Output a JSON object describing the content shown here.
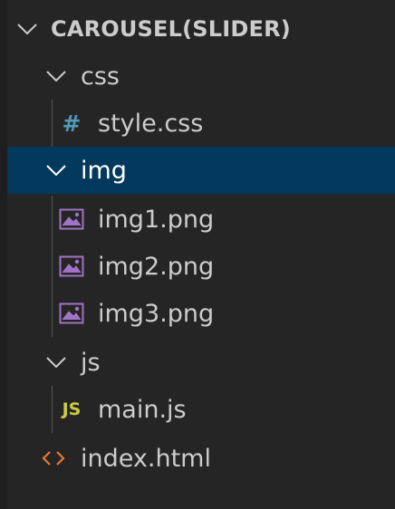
{
  "explorer": {
    "root": {
      "label": "CAROUSEL(SLIDER)",
      "expanded": true
    },
    "css_folder": {
      "label": "css",
      "expanded": true
    },
    "css_files": [
      {
        "label": "style.css",
        "icon": "css-hash-icon"
      }
    ],
    "img_folder": {
      "label": "img",
      "expanded": true,
      "selected": true
    },
    "img_files": [
      {
        "label": "img1.png",
        "icon": "image-icon"
      },
      {
        "label": "img2.png",
        "icon": "image-icon"
      },
      {
        "label": "img3.png",
        "icon": "image-icon"
      }
    ],
    "js_folder": {
      "label": "js",
      "expanded": true
    },
    "js_files": [
      {
        "label": "main.js",
        "icon": "js-icon"
      }
    ],
    "root_files": [
      {
        "label": "index.html",
        "icon": "html-icon"
      }
    ]
  },
  "colors": {
    "background": "#252526",
    "selection": "#04395e",
    "text": "#cccccc",
    "css_icon": "#519aba",
    "image_icon": "#a074c4",
    "js_icon": "#cbcb41",
    "html_icon": "#e37933"
  }
}
